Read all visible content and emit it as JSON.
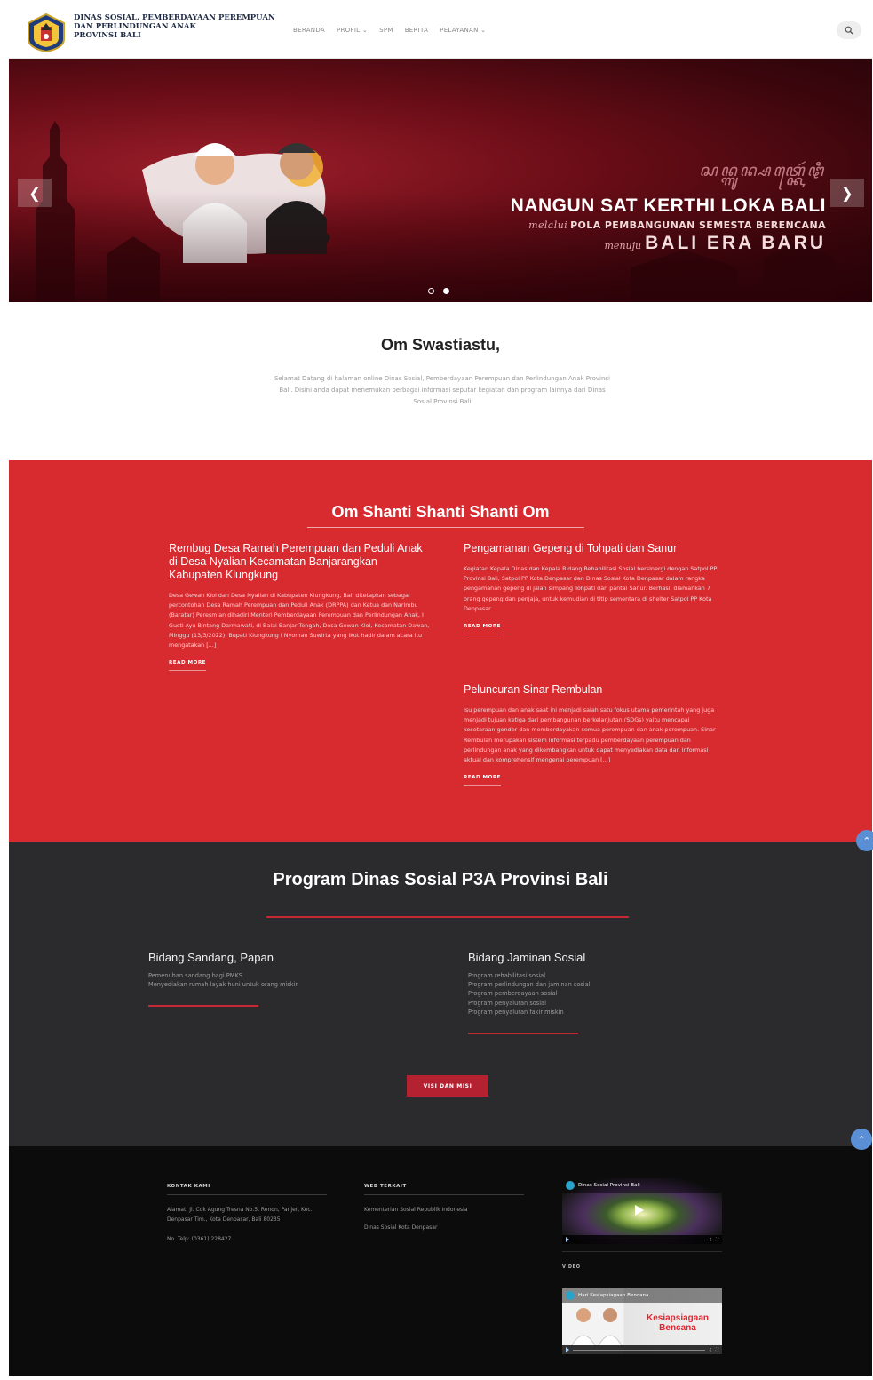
{
  "header": {
    "brand_lines": [
      "DINAS SOSIAL, PEMBERDAYAAN PEREMPUAN",
      "DAN PERLINDUNGAN ANAK",
      "PROVINSI BALI"
    ],
    "nav": [
      "BERANDA",
      "PROFIL ⌄",
      "SPM",
      "BERITA",
      "PELAYANAN ⌄"
    ],
    "search_icon": "search-icon"
  },
  "hero": {
    "script_line": "ꦱꦤ꧀ꦒꦸꦤ꧀ꦱꦠ꧀ꦏꦺꦂꦛꦶ",
    "main": "NANGUN SAT KERTHI LOKA BALI",
    "sub_prefix": "melalui",
    "sub": "POLA PEMBANGUNAN SEMESTA BERENCANA",
    "era_prefix": "menuju",
    "era": "BALI ERA BARU",
    "prev_icon": "chevron-left-icon",
    "next_icon": "chevron-right-icon",
    "slides": 2,
    "active_slide": 2
  },
  "welcome": {
    "title": "Om Swastiastu,",
    "text": "Selamat Datang di halaman online Dinas Sosial, Pemberdayaan Perempuan dan Perlindungan Anak Provinsi Bali. Disini anda dapat menemukan berbagai informasi seputar kegiatan dan program lainnya dari Dinas Sosial Provinsi Bali"
  },
  "news": {
    "title": "Om Shanti Shanti Shanti Om",
    "read_more": "READ MORE",
    "posts": [
      {
        "title": "Rembug Desa Ramah Perempuan dan Peduli Anak di Desa Nyalian Kecamatan Banjarangkan Kabupaten Klungkung",
        "excerpt": "Desa Gewan Kloi dan Desa Nyalian di Kabupaten Klungkung, Bali ditetapkan sebagai percontohan Desa Ramah Perempuan dan Peduli Anak (DRPPA) dan Ketua dan Narimbu (Baratar) Peresmian dihadiri Menteri Pemberdayaan Perempuan dan Perlindungan Anak, I Gusti Ayu Bintang Darmawati, di Balai Banjar Tengah, Desa Gewan Kloi, Kecamatan Dawan, Minggu (13/3/2022). Bupati Klungkung I Nyoman Suwirta yang ikut hadir dalam acara itu mengatakan [...]"
      },
      {
        "title": "Pengamanan Gepeng di Tohpati dan Sanur",
        "excerpt": "Kegiatan Kepala Dinas dan Kepala Bidang Rehabilitasi Sosial bersinergi dengan Satpol PP Provinsi Bali, Satpol PP Kota Denpasar dan Dinas Sosial Kota Denpasar dalam rangka pengamanan gepeng di jalan simpang Tohpati dan pantai Sanur. Berhasil diamankan 7 orang gepeng dan penjaja, untuk kemudian di titip sementara di shelter Satpol PP Kota Denpasar."
      },
      {
        "title": "Peluncuran Sinar Rembulan",
        "excerpt": "Isu perempuan dan anak saat ini menjadi salah satu fokus utama pemerintah yang juga menjadi tujuan ketiga dari pembangunan berkelanjutan (SDGs) yaitu mencapai kesetaraan gender dan memberdayakan semua perempuan dan anak perempuan. Sinar Rembulan merupakan sistem informasi terpadu pemberdayaan perempuan dan perlindungan anak yang dikembangkan untuk dapat menyediakan data dan informasi aktual dan komprehensif mengenai perempuan [...]"
      }
    ]
  },
  "programs": {
    "title": "Program Dinas Sosial P3A Provinsi Bali",
    "cols": [
      {
        "title": "Bidang Sandang, Papan",
        "items": [
          "Pemenuhan sandang bagi PMKS",
          "Menyediakan rumah layak huni untuk orang miskin"
        ]
      },
      {
        "title": "Bidang Jaminan Sosial",
        "items": [
          "Program rehabilitasi sosial",
          "Program perlindungan dan jaminan sosial",
          "Program pemberdayaan sosial",
          "Program penyaluran sosial",
          "Program penyaluran fakir miskin"
        ]
      }
    ],
    "button": "VISI DAN MISI"
  },
  "footer": {
    "kontak_head": "KONTAK KAMI",
    "alamat": "Alamat: Jl. Cok Agung Tresna No.5, Renon, Panjer, Kec. Denpasar Tim., Kota Denpasar, Bali 80235",
    "telp": "No. Telp: (0361) 228427",
    "web_head": "WEB TERKAIT",
    "links": [
      "Kementerian Sosial Republik Indonesia",
      "Dinas Sosial Kota Denpasar"
    ],
    "video1_title": "Dinas Sosial Provinsi Bali",
    "video_label": "VIDEO",
    "video2_title": "Hari Kesiapsiagaan Bencana...",
    "video2_caption": "Kesiapsiagaan Bencana"
  },
  "colors": {
    "accent_red": "#d82b30",
    "dark_section": "#2b2b2d",
    "footer_bg": "#0c0c0d",
    "button_red": "#b42232"
  }
}
